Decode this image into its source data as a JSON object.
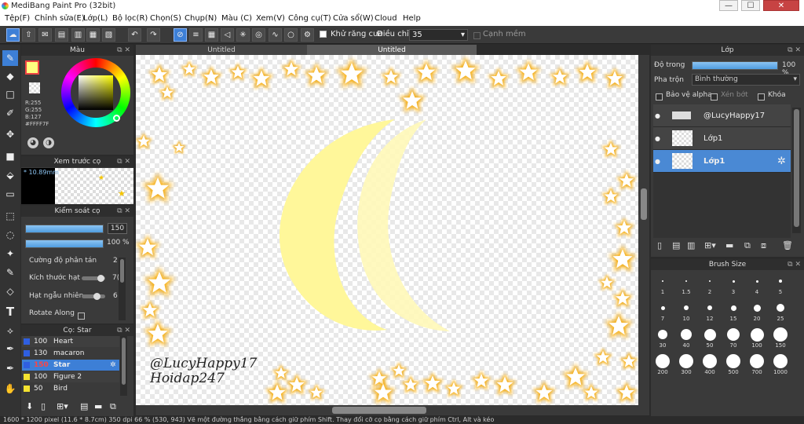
{
  "title": {
    "app": "MediBang Paint Pro (32bit)",
    "minimize": "—",
    "maximize": "☐",
    "close": "✕"
  },
  "menu": [
    "Tệp(F)",
    "Chỉnh sửa(E)",
    "Lớp(L)",
    "Bộ lọc(R)",
    "Chọn(S)",
    "Chụp(N)",
    "Màu (C)",
    "Xem(V)",
    "Công cụ(T)",
    "Cửa sổ(W)",
    "Cloud",
    "Help"
  ],
  "toolbar": {
    "antialias": "Khử răng cưa",
    "adjust": "Điều chỉnh",
    "adjust_value": "35",
    "edge": "Cạnh mềm"
  },
  "tabs": [
    "Untitled",
    "Untitled"
  ],
  "color_panel": {
    "title": "Màu",
    "r": "R:255",
    "g": "G:255",
    "b": "B:127",
    "hex": "#FFFF7F"
  },
  "preview_panel": {
    "title": "Xem trước cọ",
    "size": "* 10.89mm"
  },
  "brush_control": {
    "title": "Kiểm soát cọ",
    "size_value": "150",
    "opacity_value": "100 %",
    "props": [
      {
        "label": "Cường độ phân tán",
        "value": "2"
      },
      {
        "label": "Kích thước hạt",
        "value": "7("
      },
      {
        "label": "Hạt ngẫu nhiên",
        "value": "6"
      },
      {
        "label": "Rotate Along",
        "value": ""
      }
    ]
  },
  "brush_list": {
    "title": "Cọ: Star",
    "items": [
      {
        "size": "100",
        "name": "Heart",
        "color": "#2f5fe0"
      },
      {
        "size": "130",
        "name": "macaron",
        "color": "#2f5fe0"
      },
      {
        "size": "150",
        "name": "Star",
        "color": "#2f5fe0",
        "selected": true
      },
      {
        "size": "100",
        "name": "Figure 2",
        "color": "#f4e230"
      },
      {
        "size": "50",
        "name": "Bird",
        "color": "#f4e230"
      }
    ]
  },
  "layer_panel": {
    "title": "Lớp",
    "opacity_label": "Độ trong",
    "opacity_value": "100 %",
    "blend_label": "Pha trộn",
    "blend_value": "Bình thường",
    "protect_alpha": "Bảo vệ alpha",
    "clip": "Xén bớt",
    "lock": "Khóa",
    "layers": [
      {
        "name": "@LucyHappy17"
      },
      {
        "name": "Lớp1"
      },
      {
        "name": "Lớp1",
        "selected": true
      }
    ]
  },
  "brush_size": {
    "title": "Brush Size",
    "sizes": [
      "1",
      "1.5",
      "2",
      "3",
      "4",
      "5",
      "7",
      "10",
      "12",
      "15",
      "20",
      "25",
      "30",
      "40",
      "50",
      "70",
      "100",
      "150",
      "200",
      "300",
      "400",
      "500",
      "700",
      "1000"
    ]
  },
  "canvas_text": {
    "line1": "@LucyHappy17",
    "line2": "Hoidap247"
  },
  "status": "1600 * 1200 pixel (11.6 * 8.7cm) 350 dpi 66 % (530, 943) Vẽ một đường thẳng bằng cách giữ phím Shift. Thay đổi cỡ cọ bằng cách giữ phím Ctrl, Alt và kéo"
}
